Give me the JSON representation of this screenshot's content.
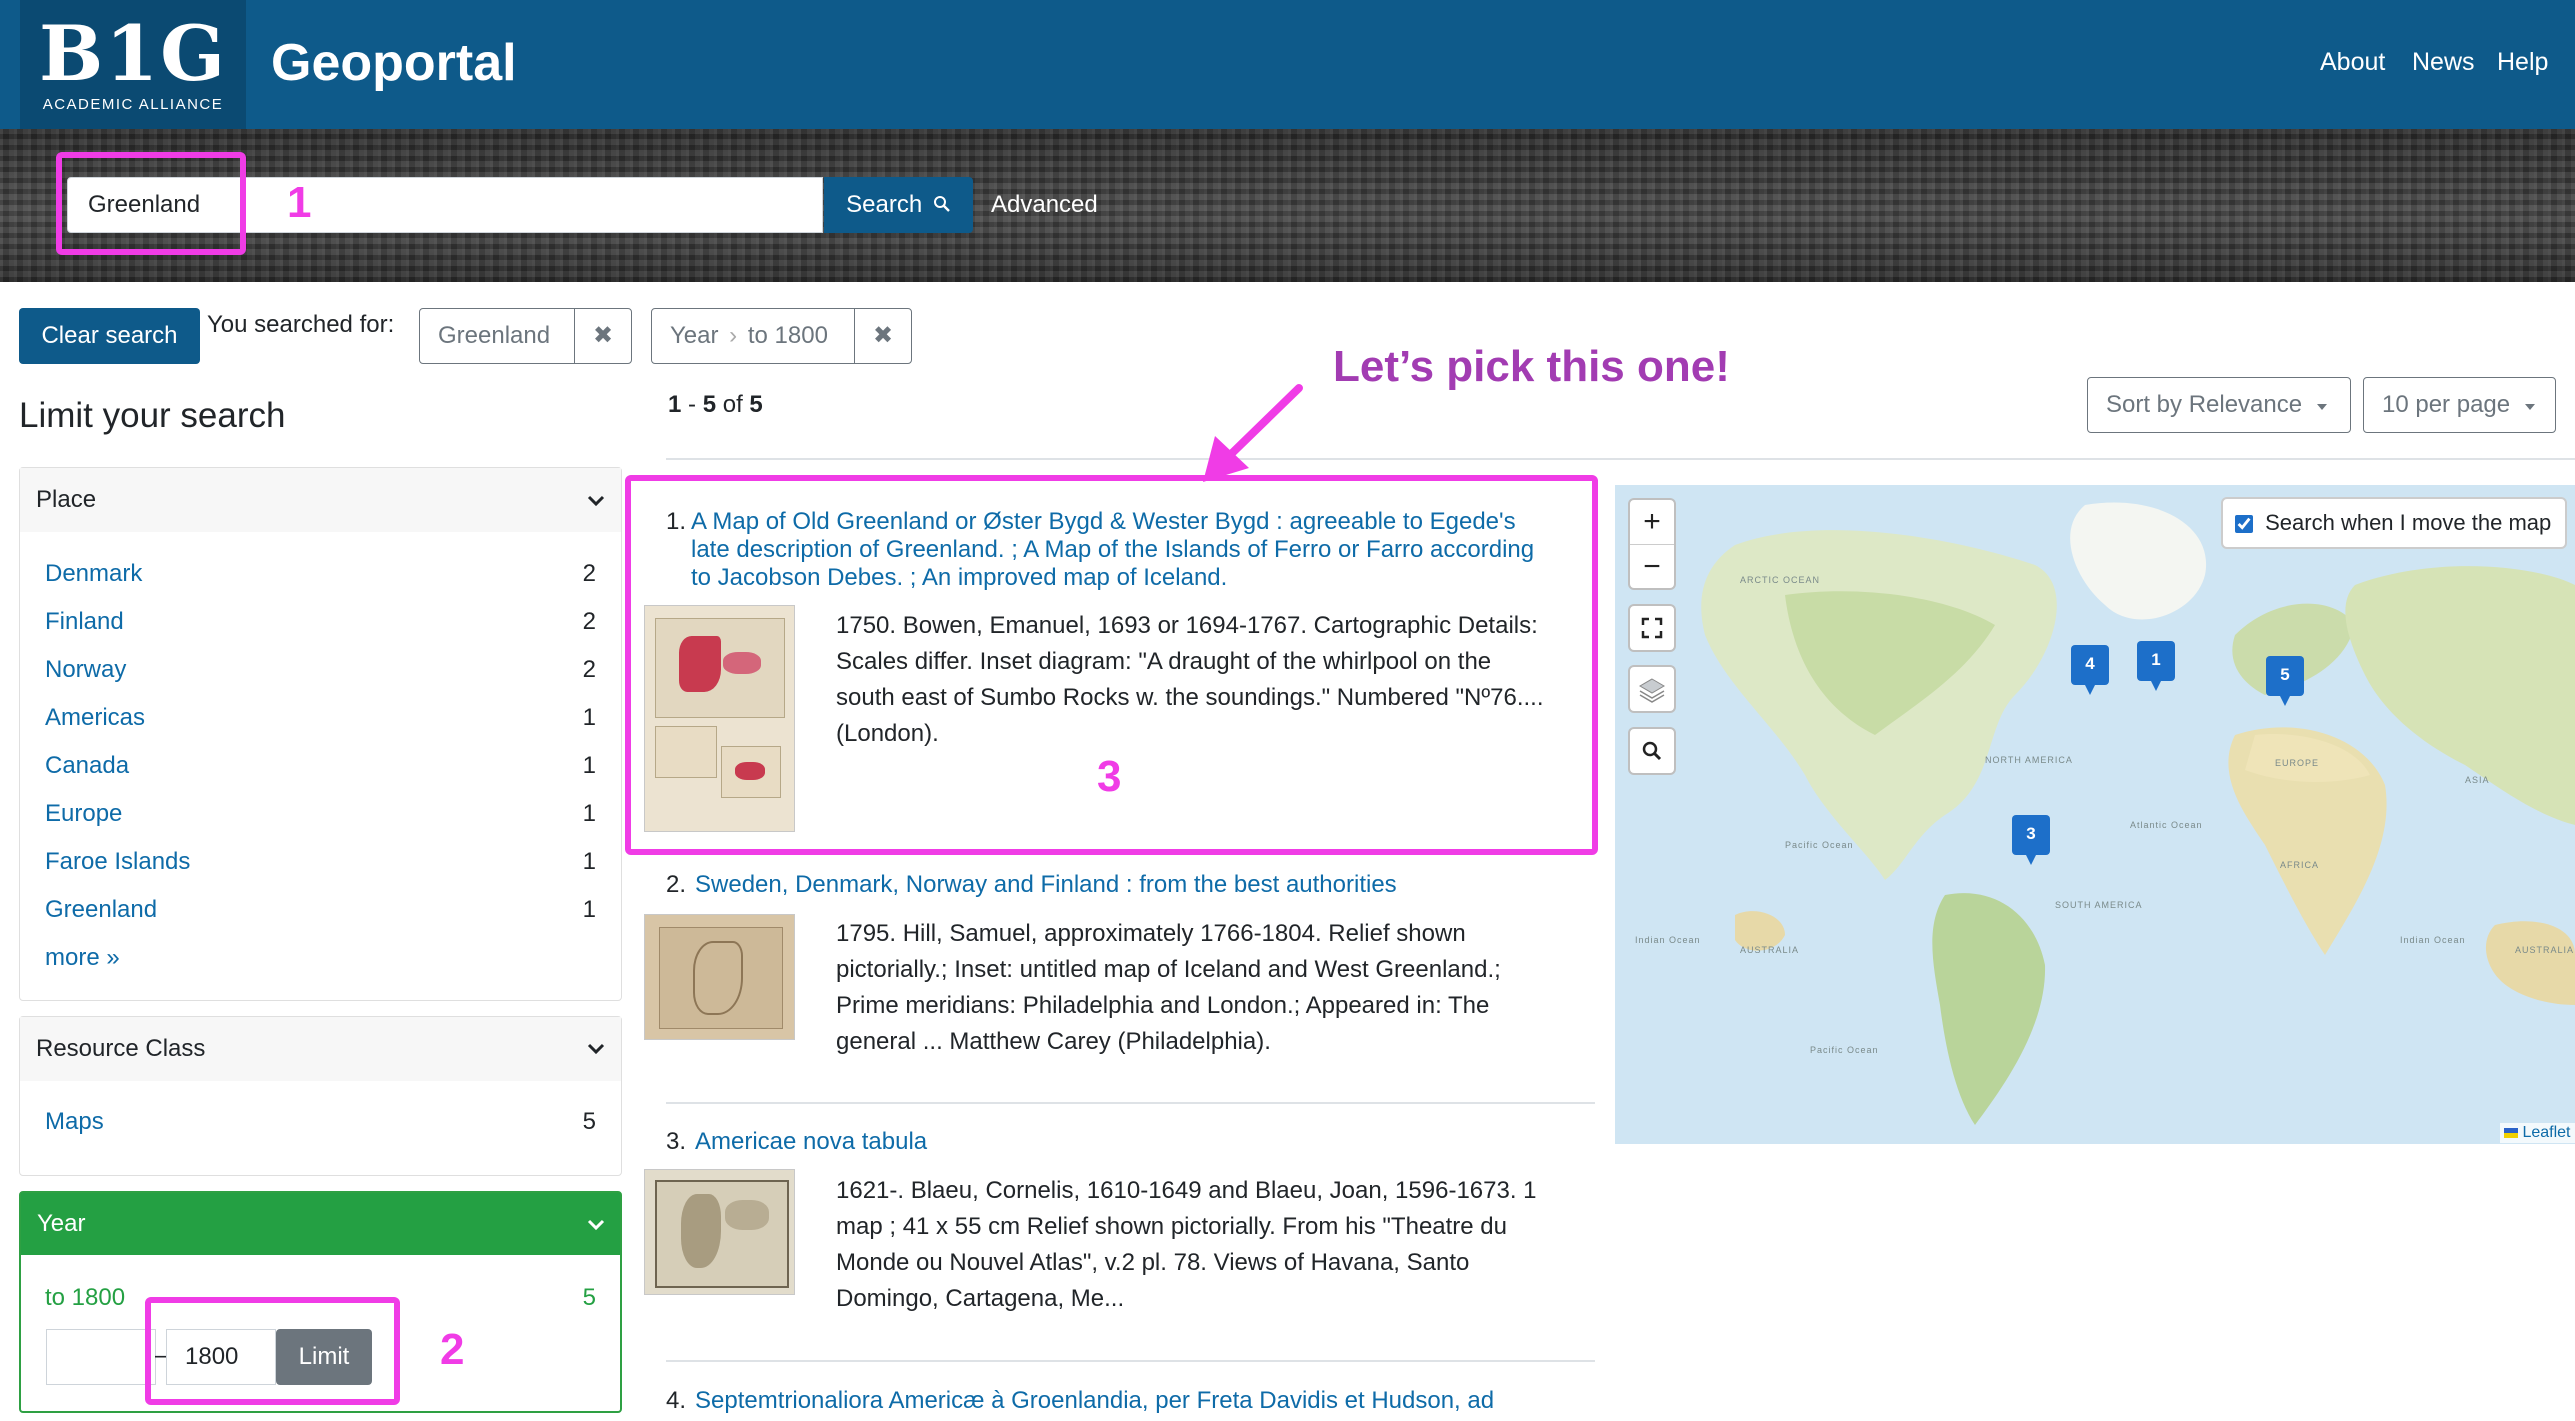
{
  "header": {
    "logo_big": "B1G",
    "logo_sub": "ACADEMIC ALLIANCE",
    "app_title": "Geoportal",
    "nav": [
      "About",
      "News",
      "Help"
    ]
  },
  "search": {
    "query": "Greenland",
    "button_label": "Search",
    "advanced_label": "Advanced"
  },
  "constraints": {
    "clear_label": "Clear search",
    "searched_for_label": "You searched for:",
    "chips": [
      {
        "value": "Greenland",
        "remove": "✖"
      },
      {
        "field": "Year",
        "separator": "›",
        "value": "to 1800",
        "remove": "✖"
      }
    ]
  },
  "sidebar": {
    "title": "Limit your search",
    "facets": [
      {
        "name": "Place",
        "items": [
          {
            "label": "Denmark",
            "count": "2"
          },
          {
            "label": "Finland",
            "count": "2"
          },
          {
            "label": "Norway",
            "count": "2"
          },
          {
            "label": "Americas",
            "count": "1"
          },
          {
            "label": "Canada",
            "count": "1"
          },
          {
            "label": "Europe",
            "count": "1"
          },
          {
            "label": "Faroe Islands",
            "count": "1"
          },
          {
            "label": "Greenland",
            "count": "1"
          }
        ],
        "more": "more »"
      },
      {
        "name": "Resource Class",
        "items": [
          {
            "label": "Maps",
            "count": "5"
          }
        ]
      },
      {
        "name": "Year",
        "selected": {
          "label": "to 1800",
          "count": "5"
        },
        "range_from": "",
        "range_to": "1800",
        "limit_label": "Limit"
      }
    ]
  },
  "results": {
    "range_start": "1",
    "range_end": "5",
    "total": "5",
    "sort_label": "Sort by Relevance",
    "per_page_label": "10 per page",
    "items": [
      {
        "num": "1.",
        "title_lines": [
          "A Map of Old Greenland or Øster Bygd & Wester Bygd : agreeable to Egede's",
          "late description of Greenland. ; A Map of the Islands of Ferro or Farro according",
          "to Jacobson Debes. ; An improved map of Iceland."
        ],
        "desc_lines": [
          "1750. Bowen, Emanuel, 1693 or 1694-1767. Cartographic Details:",
          "Scales differ. Inset diagram: \"A draught of the whirlpool on the",
          "south east of Sumbo Rocks w. the soundings.\" Numbered \"Nº76....",
          "(London)."
        ]
      },
      {
        "num": "2.",
        "title_lines": [
          "Sweden, Denmark, Norway and Finland : from the best authorities"
        ],
        "desc_lines": [
          "1795. Hill, Samuel, approximately 1766-1804. Relief shown",
          "pictorially.; Inset: untitled map of Iceland and West Greenland.;",
          "Prime meridians: Philadelphia and London.; Appeared in: The",
          "general ... Matthew Carey (Philadelphia)."
        ]
      },
      {
        "num": "3.",
        "title_lines": [
          "Americae nova tabula"
        ],
        "desc_lines": [
          "1621-. Blaeu, Cornelis, 1610-1649 and Blaeu, Joan, 1596-1673. 1",
          "map ; 41 x 55 cm Relief shown pictorially. From his \"Theatre du",
          "Monde ou Nouvel Atlas\", v.2 pl. 78. Views of Havana, Santo",
          "Domingo, Cartagena, Me..."
        ]
      },
      {
        "num": "4.",
        "title_lines": [
          "Septemtrionaliora Americæ à Groenlandia, per Freta Davidis et Hudson, ad"
        ]
      }
    ]
  },
  "map": {
    "search_when_move_label": "Search when I move the map",
    "search_when_move_checked": true,
    "zoom_in": "+",
    "zoom_out": "−",
    "markers": [
      "4",
      "1",
      "5",
      "3"
    ],
    "labels": [
      "ARCTIC OCEAN",
      "NORTH AMERICA",
      "EUROPE",
      "ASIA",
      "AFRICA",
      "SOUTH AMERICA",
      "AUSTRALIA",
      "AUSTRALIA",
      "Pacific Ocean",
      "Pacific Ocean",
      "Atlantic Ocean",
      "Indian Ocean",
      "Indian Ocean"
    ],
    "attribution": "Leaflet"
  },
  "annotations": {
    "n1": "1",
    "n2": "2",
    "n3": "3",
    "callout": "Let’s pick this one!",
    "color": "#f03ce6",
    "callout_color": "#a23cb2"
  },
  "colors": {
    "header_bg": "#0e5a8a",
    "link": "#0e6ba8",
    "year_facet": "#24a043",
    "marker": "#1d6fc9"
  }
}
